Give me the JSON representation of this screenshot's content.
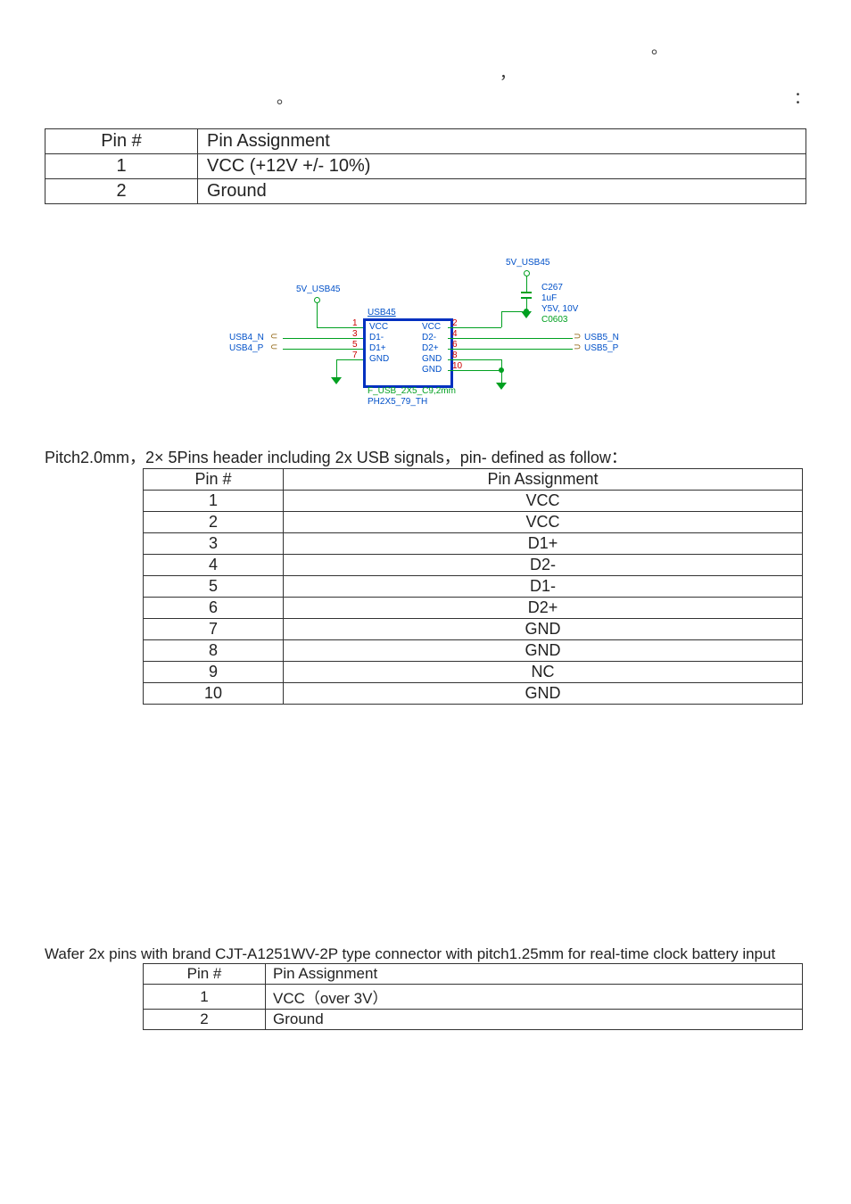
{
  "intro": {
    "line1_right_dot": "。",
    "line2_comma": "，",
    "line2_end_dot": "。",
    "line2_colon": "："
  },
  "table1": {
    "header_pin": "Pin #",
    "header_assign": "Pin Assignment",
    "rows": [
      {
        "pin": "1",
        "assign": "VCC (+12V +/- 10%)"
      },
      {
        "pin": "2",
        "assign": "Ground"
      }
    ]
  },
  "schematic": {
    "net_top": "5V_USB45",
    "net_top2": "5V_USB45",
    "usb45_label": "USB45",
    "left_sig1": "USB4_N",
    "left_sig2": "USB4_P",
    "right_sig1": "USB5_N",
    "right_sig2": "USB5_P",
    "cap_ref": "C267",
    "cap_val1": "1uF",
    "cap_val2": "Y5V, 10V",
    "cap_pkg": "C0603",
    "pins_left": [
      "1",
      "3",
      "5",
      "7"
    ],
    "pins_right": [
      "2",
      "4",
      "6",
      "8",
      "10"
    ],
    "chip_labels_left": [
      "VCC",
      "D1-",
      "D1+",
      "GND"
    ],
    "chip_labels_right": [
      "VCC",
      "D2-",
      "D2+",
      "GND",
      "GND"
    ],
    "footprint1": "F_USB_2X5_C9,2mm",
    "footprint2": "PH2X5_79_TH"
  },
  "desc2": "Pitch2.0mm，2× 5Pins header including 2x USB signals，pin- defined as follow：",
  "table2": {
    "header_pin": "Pin #",
    "header_assign": "Pin Assignment",
    "rows": [
      {
        "pin": "1",
        "assign": "VCC"
      },
      {
        "pin": "2",
        "assign": "VCC"
      },
      {
        "pin": "3",
        "assign": "D1+"
      },
      {
        "pin": "4",
        "assign": "D2-"
      },
      {
        "pin": "5",
        "assign": "D1-"
      },
      {
        "pin": "6",
        "assign": "D2+"
      },
      {
        "pin": "7",
        "assign": "GND"
      },
      {
        "pin": "8",
        "assign": "GND"
      },
      {
        "pin": "9",
        "assign": "NC"
      },
      {
        "pin": "10",
        "assign": "GND"
      }
    ]
  },
  "desc3": "Wafer 2x pins with brand CJT-A1251WV-2P type connector with pitch1.25mm for real-time clock battery input",
  "table3": {
    "header_pin": "Pin #",
    "header_assign": "Pin Assignment",
    "rows": [
      {
        "pin": "1",
        "assign": "VCC（over 3V）"
      },
      {
        "pin": "2",
        "assign": "Ground"
      }
    ]
  }
}
